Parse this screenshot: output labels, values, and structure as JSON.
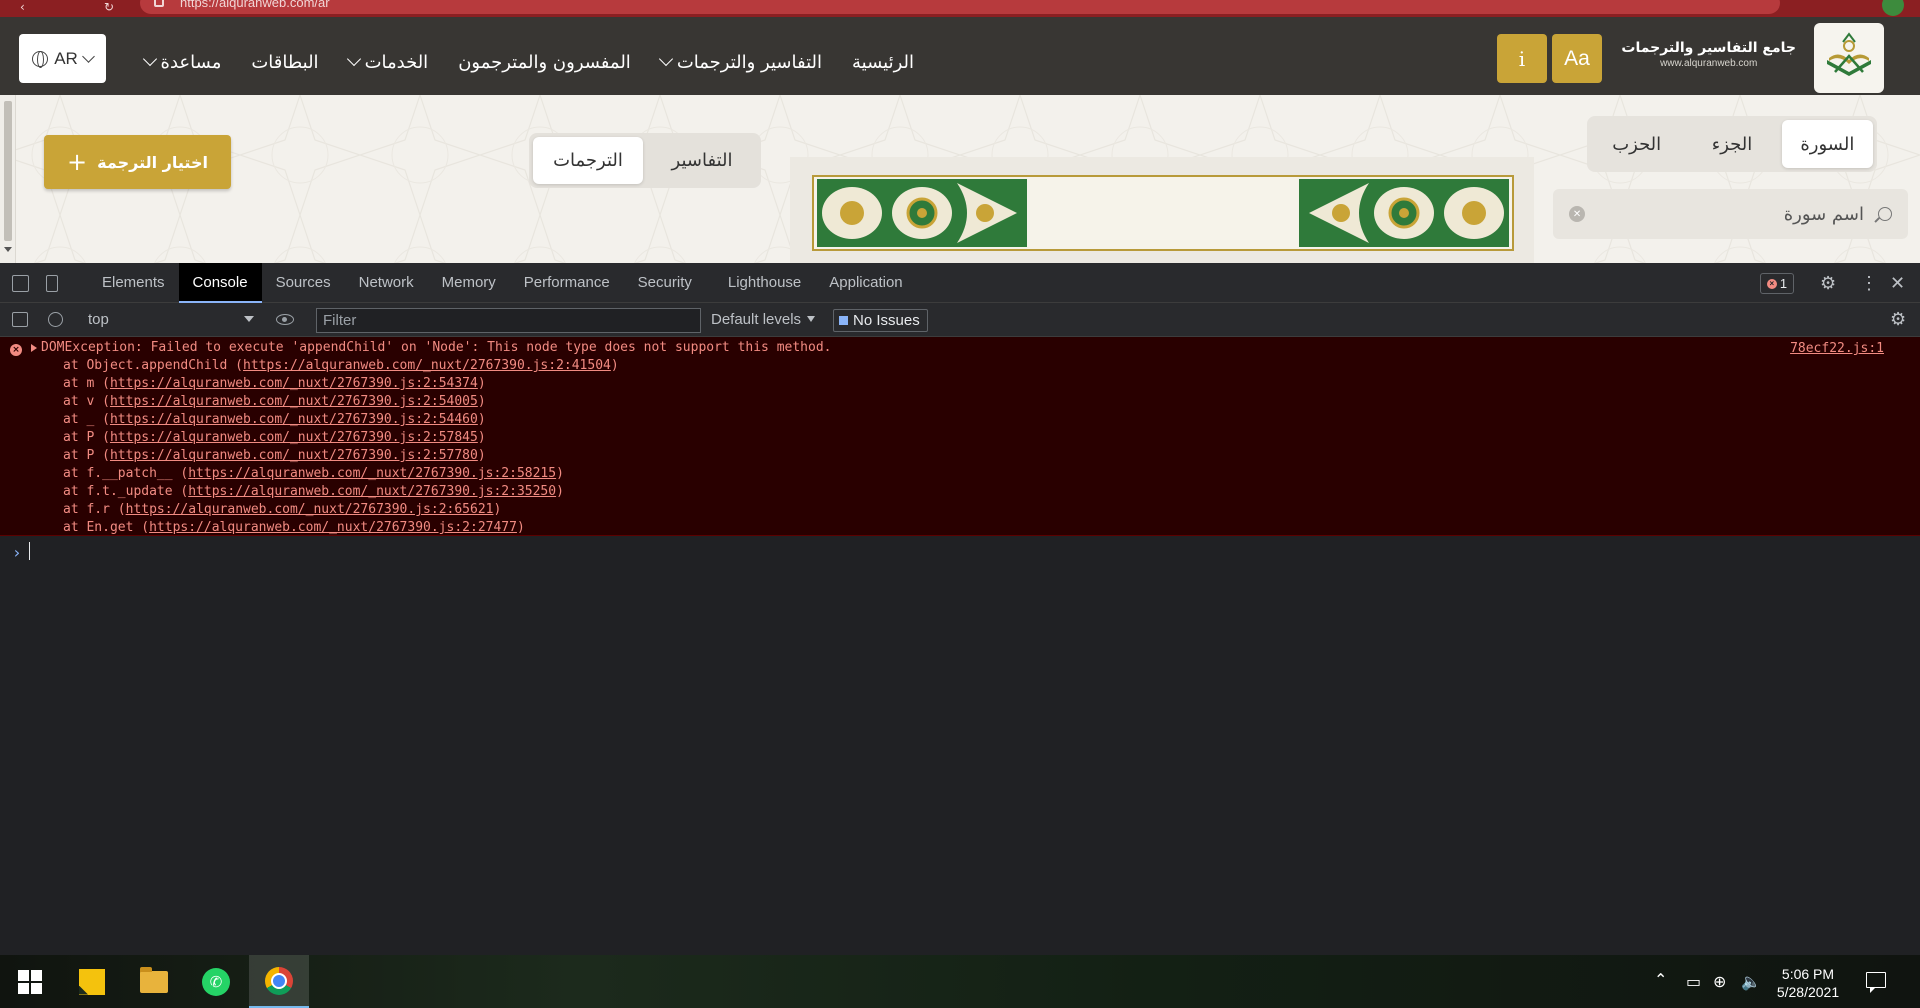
{
  "browser": {
    "url": "https://alquranweb.com/ar"
  },
  "site": {
    "brand_name": "جامع التفاسير والترجمات",
    "brand_url": "www.alquranweb.com",
    "font_btn_label": "Aa",
    "info_btn_label": "i",
    "nav": [
      {
        "label": "الرئيسية"
      },
      {
        "label": "التفاسير والترجمات"
      },
      {
        "label": "المفسرون والمترجمون"
      },
      {
        "label": "الخدمات"
      },
      {
        "label": "البطاقات"
      },
      {
        "label": "مساعدة"
      }
    ],
    "lang_label": "AR",
    "accent_color": "#c9a437",
    "header_color": "#383633"
  },
  "content": {
    "segments": [
      {
        "label": "السورة",
        "active": true
      },
      {
        "label": "الجزء",
        "active": false
      },
      {
        "label": "الحزب",
        "active": false
      }
    ],
    "search_placeholder": "اسم سورة",
    "tabs": [
      {
        "label": "التفاسير",
        "active": false
      },
      {
        "label": "الترجمات",
        "active": true
      }
    ],
    "choose_button": "اختيار الترجمة"
  },
  "devtools": {
    "tabs": [
      "Elements",
      "Console",
      "Sources",
      "Network",
      "Memory",
      "Performance",
      "Security",
      "Lighthouse",
      "Application"
    ],
    "active_tab": "Console",
    "error_count": "1",
    "context": "top",
    "filter_placeholder": "Filter",
    "levels": "Default levels",
    "issues": "No Issues",
    "error": {
      "message": "DOMException: Failed to execute 'appendChild' on 'Node': This node type does not support this method.",
      "source": "78ecf22.js:1",
      "stack": [
        {
          "prefix": "at Object.appendChild (",
          "url": "https://alquranweb.com/_nuxt/2767390.js:2:41504",
          "suffix": ")"
        },
        {
          "prefix": "at m (",
          "url": "https://alquranweb.com/_nuxt/2767390.js:2:54374",
          "suffix": ")"
        },
        {
          "prefix": "at v (",
          "url": "https://alquranweb.com/_nuxt/2767390.js:2:54005",
          "suffix": ")"
        },
        {
          "prefix": "at _ (",
          "url": "https://alquranweb.com/_nuxt/2767390.js:2:54460",
          "suffix": ")"
        },
        {
          "prefix": "at P (",
          "url": "https://alquranweb.com/_nuxt/2767390.js:2:57845",
          "suffix": ")"
        },
        {
          "prefix": "at P (",
          "url": "https://alquranweb.com/_nuxt/2767390.js:2:57780",
          "suffix": ")"
        },
        {
          "prefix": "at f.__patch__ (",
          "url": "https://alquranweb.com/_nuxt/2767390.js:2:58215",
          "suffix": ")"
        },
        {
          "prefix": "at f.t._update (",
          "url": "https://alquranweb.com/_nuxt/2767390.js:2:35250",
          "suffix": ")"
        },
        {
          "prefix": "at f.r (",
          "url": "https://alquranweb.com/_nuxt/2767390.js:2:65621",
          "suffix": ")"
        },
        {
          "prefix": "at En.get (",
          "url": "https://alquranweb.com/_nuxt/2767390.js:2:27477",
          "suffix": ")"
        }
      ],
      "color": "#f28b82"
    }
  },
  "taskbar": {
    "apps": [
      "windows-start",
      "sticky-notes",
      "file-explorer",
      "whatsapp",
      "chrome"
    ],
    "time": "5:06 PM",
    "date": "5/28/2021"
  }
}
